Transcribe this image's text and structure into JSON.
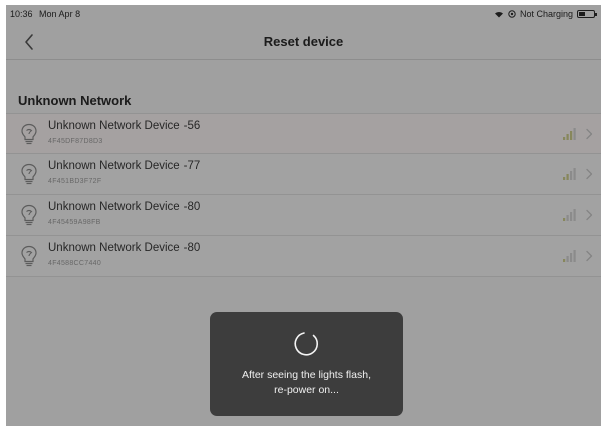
{
  "status_bar": {
    "time": "10:36",
    "date": "Mon Apr 8",
    "battery_status": "Not Charging",
    "icons": [
      "wifi-icon",
      "lock-icon",
      "battery-icon"
    ]
  },
  "nav": {
    "title": "Reset device",
    "back_icon": "chevron-left-icon"
  },
  "section": {
    "title": "Unknown Network"
  },
  "devices": [
    {
      "name": "Unknown Network Device",
      "rssi": "-56",
      "mac": "4F45DF87D8D3",
      "signal_bars": 3
    },
    {
      "name": "Unknown Network Device",
      "rssi": "-77",
      "mac": "4F451BD3F72F",
      "signal_bars": 2
    },
    {
      "name": "Unknown Network Device",
      "rssi": "-80",
      "mac": "4F45459A98FB",
      "signal_bars": 1
    },
    {
      "name": "Unknown Network Device",
      "rssi": "-80",
      "mac": "4F4588CC7440",
      "signal_bars": 1
    }
  ],
  "hud": {
    "message": "After seeing the lights flash,\nre-power on..."
  },
  "colors": {
    "background": "#efefef",
    "hud_background": "#3d3d3d",
    "signal_active": "#c9c98a",
    "signal_inactive": "#cfcfcf"
  }
}
